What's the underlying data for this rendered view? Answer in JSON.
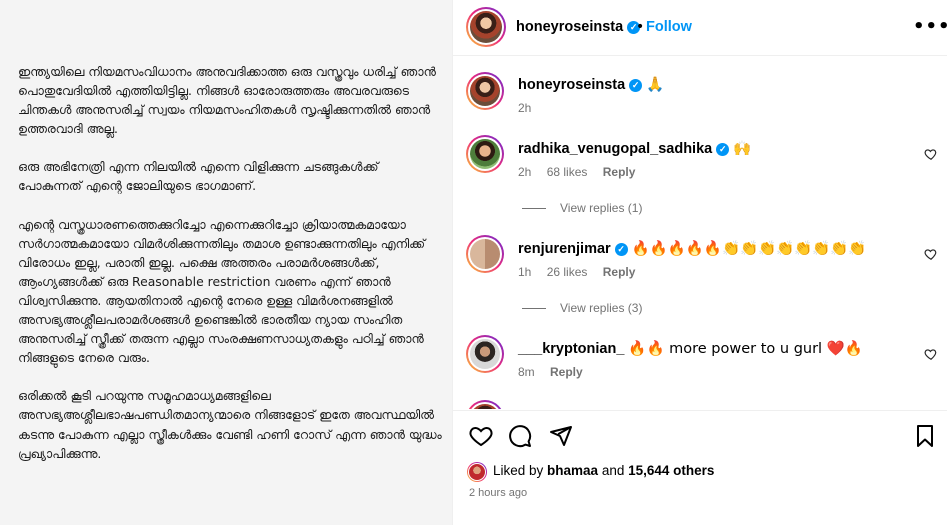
{
  "post_image": {
    "paragraphs": [
      "ഇന്ത്യയിലെ നിയമസംവിധാനം അനുവദിക്കാത്ത ഒരു വസ്ത്രവും ധരിച്ച് ഞാൻ പൊതുവേദിയിൽ എത്തിയിട്ടില്ല. നിങ്ങൾ ഓരോരുത്തരും അവരവരുടെ ചിന്തകൾ അനുസരിച്ച് സ്വയം നിയമസംഹിതകൾ സൃഷ്ടിക്കുന്നതിൽ ഞാൻ ഉത്തരവാദി അല്ല.",
      "ഒരു അഭിനേത്രി എന്ന നിലയിൽ എന്നെ വിളിക്കുന്ന ചടങ്ങുകൾക്ക് പോകുന്നത് എന്റെ ജോലിയുടെ ഭാഗമാണ്.",
      "എന്റെ വസ്ത്രധാരണത്തെക്കുറിച്ചോ എന്നെക്കുറിച്ചോ ക്രിയാത്മകമായോ സർഗാത്മകമായോ വിമർശിക്കുന്നതിലും തമാശ ഉണ്ടാക്കുന്നതിലും എനിക്ക് വിരോധം ഇല്ല, പരാതി ഇല്ല. പക്ഷെ അത്തരം പരാമർശങ്ങൾക്ക്, ആംഗ്യങ്ങൾക്ക് ഒരു Reasonable restriction വരണം എന്ന് ഞാൻ വിശ്വസിക്കുന്നു. ആയതിനാൽ എന്റെ നേരെ ഉള്ള വിമർശനങ്ങളിൽ അസഭ്യഅശ്ലീലപരാമർശങ്ങൾ ഉണ്ടെങ്കിൽ ഭാരതീയ ന്യായ സംഹിത അനുസരിച്ച് സ്ത്രീക്ക് തരുന്ന എല്ലാ സംരക്ഷണസാധ്യതകളും പഠിച്ച് ഞാൻ നിങ്ങളുടെ നേരെ വരും.",
      "ഒരിക്കൽ കൂടി പറയുന്നു സമൂഹമാധ്യമങ്ങളിലെ അസഭ്യഅശ്ലീലഭാഷപണ്ഡിതമാന്യന്മാരെ നിങ്ങളോട് ഇതേ അവസ്ഥയിൽ കടന്നു പോകുന്ന എല്ലാ സ്ത്രീകൾക്കും വേണ്ടി ഹണി റോസ് എന്ന ഞാൻ യുദ്ധം പ്രഖ്യാപിക്കുന്നു."
    ]
  },
  "header": {
    "username": "honeyroseinsta",
    "separator": "•",
    "follow_label": "Follow",
    "more_label": "•••"
  },
  "caption": {
    "username": "honeyroseinsta",
    "text": "🙏",
    "time": "2h"
  },
  "comments": [
    {
      "username": "radhika_venugopal_sadhika",
      "text": "🙌",
      "time": "2h",
      "likes": "68 likes",
      "reply": "Reply",
      "view_replies": "View replies (1)"
    },
    {
      "username": "renjurenjimar",
      "text": "🔥🔥🔥🔥🔥👏👏👏👏👏👏👏👏",
      "time": "1h",
      "likes": "26 likes",
      "reply": "Reply",
      "view_replies": "View replies (3)"
    },
    {
      "username": "___kryptonian_",
      "text": "🔥🔥 more power to u gurl ❤️🔥",
      "time": "8m",
      "likes": "",
      "reply": "Reply",
      "view_replies": ""
    }
  ],
  "footer": {
    "liked_by_prefix": "Liked by ",
    "liked_by_user": "bhamaa",
    "liked_by_and": " and ",
    "liked_by_count": "15,644 others",
    "time_ago": "2 hours ago"
  },
  "icons": {
    "verified": "verified-badge-icon",
    "like": "heart-icon",
    "comment": "comment-icon",
    "share": "share-icon",
    "save": "bookmark-icon",
    "more": "more-options-icon"
  },
  "colors": {
    "accent": "#0095f6",
    "muted": "#737373",
    "border": "#efefef"
  }
}
